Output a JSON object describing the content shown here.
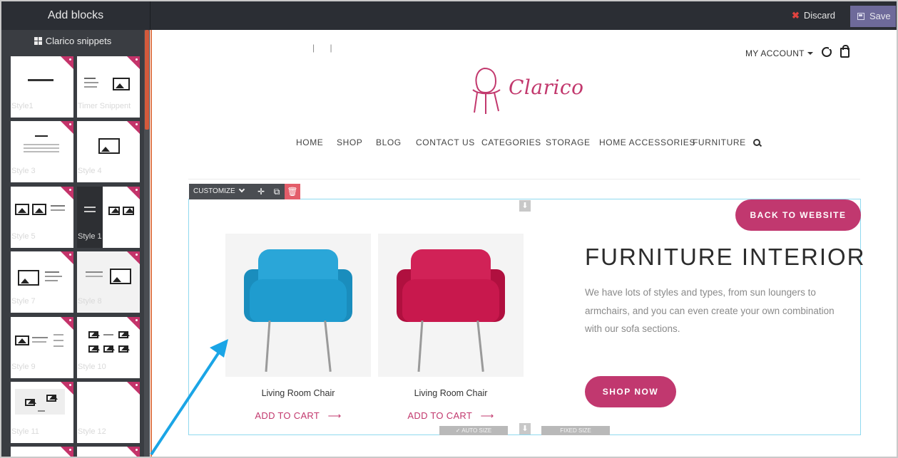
{
  "editor": {
    "panel_title": "Add blocks",
    "discard_label": "Discard",
    "save_label": "Save",
    "snippet_group": "Clarico snippets",
    "blocks": [
      {
        "label": "Style1"
      },
      {
        "label": "Timer Snippent"
      },
      {
        "label": "Style 3"
      },
      {
        "label": "Style 4"
      },
      {
        "label": "Style 5"
      },
      {
        "label": "Style 1"
      },
      {
        "label": "Style 7"
      },
      {
        "label": "Style 8"
      },
      {
        "label": "Style 9"
      },
      {
        "label": "Style 10"
      },
      {
        "label": "Style 11"
      },
      {
        "label": "Style 12"
      }
    ],
    "toolbar": {
      "customize_label": "CUSTOMIZE"
    },
    "auto_size_label": "AUTO SIZE",
    "fixed_size_label": "FIXED SIZE"
  },
  "site": {
    "top_links": "| |",
    "account_label": "MY ACCOUNT",
    "brand": "Clarico",
    "nav": [
      "HOME",
      "SHOP",
      "BLOG",
      "CONTACT US",
      "CATEGORIES",
      "STORAGE",
      "HOME ACCESSORIES",
      "FURNITURE"
    ],
    "back_button": "BACK TO WEBSITE",
    "products": [
      {
        "name": "Living Room Chair",
        "cta": "ADD TO CART",
        "color": "#1f9ccf"
      },
      {
        "name": "Living Room Chair",
        "cta": "ADD TO CART",
        "color": "#c8184d"
      }
    ],
    "headline": "FURNITURE INTERIOR",
    "description": "We have lots of styles and types, from sun loungers to armchairs, and you can even create your own combination with our sofa sections.",
    "shop_button": "SHOP NOW",
    "accent_color": "#c1386f"
  }
}
